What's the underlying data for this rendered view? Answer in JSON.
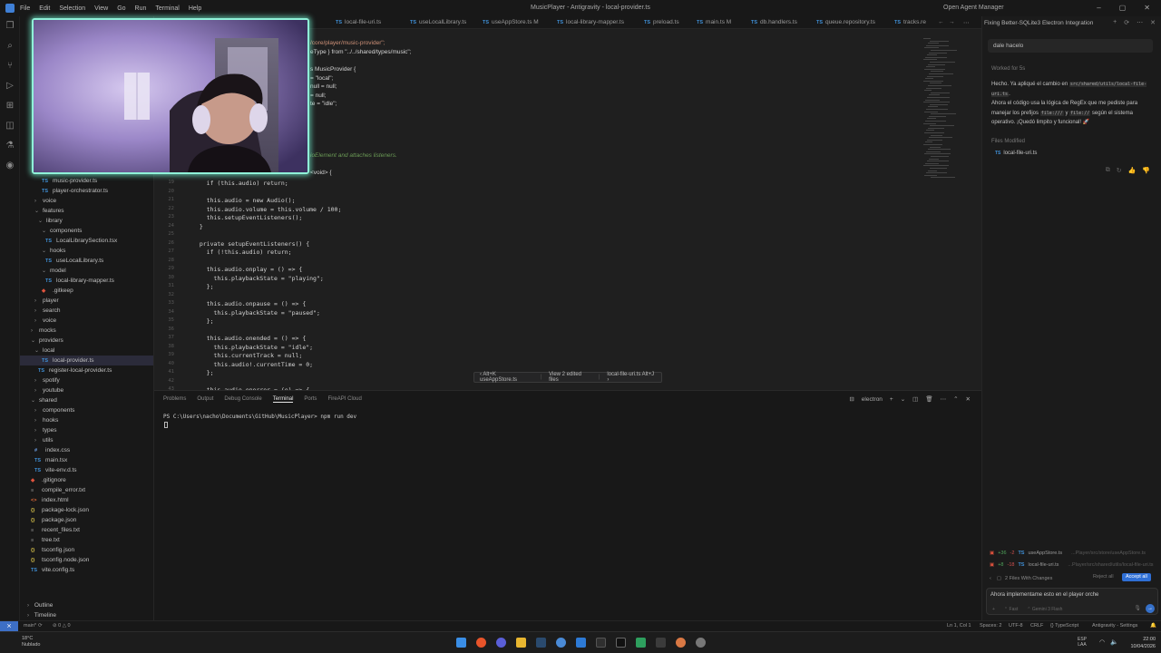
{
  "menu": [
    "File",
    "Edit",
    "Selection",
    "View",
    "Go",
    "Run",
    "Terminal",
    "Help"
  ],
  "window_title": "MusicPlayer - Antigravity - local-provider.ts",
  "agent_manager": "Open Agent Manager",
  "tabs": [
    "local-file-uri.ts",
    "useLocalLibrary.ts",
    "useAppStore.ts M",
    "local-library-mapper.ts",
    "preload.ts",
    "main.ts M",
    "db.handlers.ts",
    "queue.repository.ts",
    "tracks.re"
  ],
  "explorer": [
    {
      "label": "player",
      "kind": "folder",
      "open": true
    },
    {
      "label": "music-provider.ts",
      "kind": "ts"
    },
    {
      "label": "player-orchestrator.ts",
      "kind": "ts"
    },
    {
      "label": "voice",
      "kind": "folder"
    },
    {
      "label": "features",
      "kind": "folder",
      "open": true
    },
    {
      "label": "library",
      "kind": "folder",
      "open": true
    },
    {
      "label": "components",
      "kind": "folder",
      "open": true
    },
    {
      "label": "LocalLibrarySection.tsx",
      "kind": "ts"
    },
    {
      "label": "hooks",
      "kind": "folder",
      "open": true
    },
    {
      "label": "useLocalLibrary.ts",
      "kind": "ts"
    },
    {
      "label": "model",
      "kind": "folder",
      "open": true
    },
    {
      "label": "local-library-mapper.ts",
      "kind": "ts"
    },
    {
      "label": ".gitkeep",
      "kind": "git"
    },
    {
      "label": "player",
      "kind": "folder"
    },
    {
      "label": "search",
      "kind": "folder"
    },
    {
      "label": "voice",
      "kind": "folder"
    },
    {
      "label": "mocks",
      "kind": "folder"
    },
    {
      "label": "providers",
      "kind": "folder",
      "open": true
    },
    {
      "label": "local",
      "kind": "folder",
      "open": true
    },
    {
      "label": "local-provider.ts",
      "kind": "ts",
      "active": true
    },
    {
      "label": "register-local-provider.ts",
      "kind": "ts"
    },
    {
      "label": "spotify",
      "kind": "folder"
    },
    {
      "label": "youtube",
      "kind": "folder"
    },
    {
      "label": "shared",
      "kind": "folder",
      "open": true
    },
    {
      "label": "components",
      "kind": "folder"
    },
    {
      "label": "hooks",
      "kind": "folder"
    },
    {
      "label": "types",
      "kind": "folder"
    },
    {
      "label": "utils",
      "kind": "folder"
    },
    {
      "label": "index.css",
      "kind": "css"
    },
    {
      "label": "main.tsx",
      "kind": "ts"
    },
    {
      "label": "vite-env.d.ts",
      "kind": "ts"
    },
    {
      "label": ".gitignore",
      "kind": "git"
    },
    {
      "label": "compile_error.txt",
      "kind": "txt"
    },
    {
      "label": "index.html",
      "kind": "html"
    },
    {
      "label": "package-lock.json",
      "kind": "json"
    },
    {
      "label": "package.json",
      "kind": "json"
    },
    {
      "label": "recent_files.txt",
      "kind": "txt"
    },
    {
      "label": "tree.txt",
      "kind": "txt"
    },
    {
      "label": "tsconfig.json",
      "kind": "json"
    },
    {
      "label": "tsconfig.node.json",
      "kind": "json"
    },
    {
      "label": "vite.config.ts",
      "kind": "ts"
    }
  ],
  "outline_label": "Outline",
  "timeline_label": "Timeline",
  "code_top": [
    "/core/player/music-provider\";",
    "eType } from \"../../shared/types/music\";",
    "",
    "s MusicProvider {",
    "= \"local\";",
    "null = null;",
    "= null;",
    "te = \"idle\";"
  ],
  "code_comment": "ioElement and attaches listeners.",
  "code_void": "<void> {",
  "code_lines": [
    {
      "n": "",
      "t": "    if (this.audio) return;"
    },
    {
      "n": "",
      "t": ""
    },
    {
      "n": "",
      "t": "    this.audio = new Audio();"
    },
    {
      "n": "",
      "t": "    this.audio.volume = this.volume / 100;"
    },
    {
      "n": "",
      "t": "    this.setupEventListeners();"
    },
    {
      "n": "",
      "t": "  }"
    },
    {
      "n": "",
      "t": ""
    },
    {
      "n": "",
      "t": "  private setupEventListeners() {"
    },
    {
      "n": "",
      "t": "    if (!this.audio) return;"
    },
    {
      "n": "",
      "t": ""
    },
    {
      "n": "",
      "t": "    this.audio.onplay = () => {"
    },
    {
      "n": "",
      "t": "      this.playbackState = \"playing\";"
    },
    {
      "n": "",
      "t": "    };"
    },
    {
      "n": "",
      "t": ""
    },
    {
      "n": "",
      "t": "    this.audio.onpause = () => {"
    },
    {
      "n": "",
      "t": "      this.playbackState = \"paused\";"
    },
    {
      "n": "",
      "t": "    };"
    },
    {
      "n": "",
      "t": ""
    },
    {
      "n": "",
      "t": "    this.audio.onended = () => {"
    },
    {
      "n": "",
      "t": "      this.playbackState = \"idle\";"
    },
    {
      "n": "",
      "t": "      this.currentTrack = null;"
    },
    {
      "n": "",
      "t": "      this.audio!.currentTime = 0;"
    },
    {
      "n": "",
      "t": "    };"
    },
    {
      "n": "",
      "t": ""
    },
    {
      "n": "",
      "t": "    this.audio.onerror = (e) => {"
    }
  ],
  "floatbar": {
    "left": "useAppStore.ts",
    "mid": "View 2 edited files",
    "right": "local-file-uri.ts"
  },
  "panel_tabs": [
    "Problems",
    "Output",
    "Debug Console",
    "Terminal",
    "Ports",
    "FireAPI Cloud"
  ],
  "panel_active": "Terminal",
  "terminal_shell": "electron",
  "terminal_line": "PS C:\\Users\\nacho\\Documents\\GitHub\\MusicPlayer> npm run dev",
  "agent": {
    "title": "Fixing Better-SQLite3 Electron Integration",
    "user_message": "dale hacelo",
    "worked_for": "Worked for 5s",
    "reply_1": "Hecho. Ya apliqué el cambio en",
    "reply_code_1": "src/shared/utils/local-file-uri.ts",
    "reply_2": "Ahora el código usa la lógica de RegEx que me pediste para manejar los prefijos",
    "reply_code_2": "file:///",
    "reply_3": "y",
    "reply_code_3": "file://",
    "reply_4": "según el sistema operativo. ¡Quedó limpito y funcional! 🚀",
    "files_modified_label": "Files Modified",
    "files_modified": "local-file-uri.ts",
    "changes": [
      {
        "add": "+36",
        "del": "-2",
        "file": "useAppStore.ts",
        "path": "...Player/src/store/useAppStore.ts"
      },
      {
        "add": "+8",
        "del": "-18",
        "file": "local-file-uri.ts",
        "path": "...Player/src/shared/utils/local-file-uri.ts"
      }
    ],
    "files_with_changes": "2 Files With Changes",
    "reject_all": "Reject all",
    "accept_all": "Accept all",
    "input_text": "Ahora implementame esto en el player orche",
    "input_mode": "Fast",
    "input_model": "Gemini 3 Flash"
  },
  "status": {
    "branch": "main*",
    "problems": "⊘ 0 △ 0",
    "position": "Ln 1, Col 1",
    "spaces": "Spaces: 2",
    "encoding": "UTF-8",
    "eol": "CRLF",
    "language": "TypeScript",
    "settings": "Antigravity - Settings"
  },
  "taskbar": {
    "weather_temp": "18°C",
    "weather_desc": "Nublado",
    "lang_1": "ESP",
    "lang_2": "LAA",
    "time": "22:00",
    "date": "10/04/2026"
  },
  "colors": {
    "accent": "#3d6fc6",
    "webcam_border": "#8ff2d8",
    "accept": "#2f6fd5"
  }
}
